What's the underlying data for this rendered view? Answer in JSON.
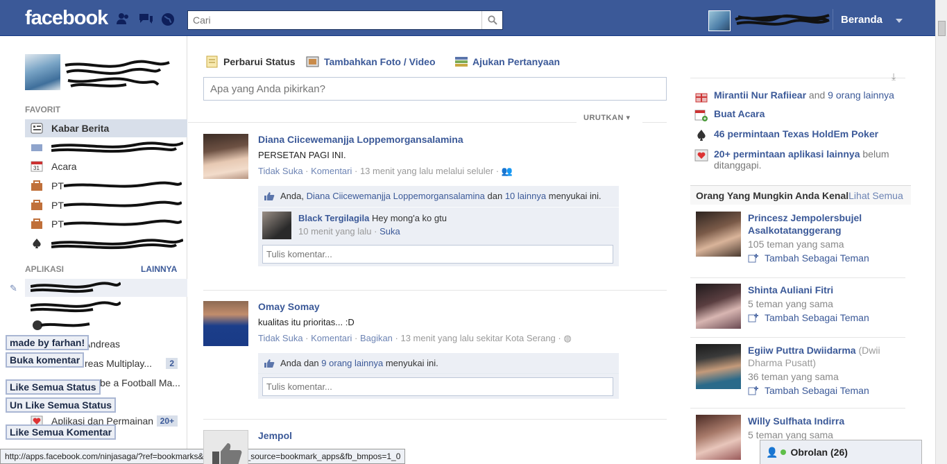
{
  "topbar": {
    "logo": "facebook",
    "search_placeholder": "Cari",
    "home_label": "Beranda"
  },
  "left": {
    "favorites_title": "FAVORIT",
    "favorites": [
      {
        "label": "Kabar Berita",
        "icon": "news-feed-icon",
        "active": true
      },
      {
        "label": "",
        "icon": "messages-icon"
      },
      {
        "label": "Acara",
        "icon": "calendar-icon"
      },
      {
        "label": "PT",
        "icon": "group-icon"
      },
      {
        "label": "PT",
        "icon": "group-icon"
      },
      {
        "label": "PT",
        "icon": "group-icon"
      },
      {
        "label": "",
        "icon": "spade-icon"
      }
    ],
    "apps_title": "APLIKASI",
    "apps_more": "LAINNYA",
    "apps": [
      {
        "label": "n Andreas"
      },
      {
        "label": "reas Multiplay...",
        "badge": "2"
      },
      {
        "label": "be a Football Ma..."
      },
      {
        "label": "Aplikasi dan Permainan",
        "badge": "20+"
      }
    ],
    "ext_buttons": [
      "made by farhan!",
      "Buka komentar",
      "Like Semua Status",
      "Un Like Semua Status",
      "Like Semua Komentar"
    ],
    "status_url": "http://apps.facebook.com/ninjasaga/?ref=bookmarks&count=0&fb_source=bookmark_apps&fb_bmpos=1_0"
  },
  "composer": {
    "tabs": [
      "Perbarui Status",
      "Tambahkan Foto / Video",
      "Ajukan Pertanyaan"
    ],
    "placeholder": "Apa yang Anda pikirkan?",
    "sort_label": "URUTKAN"
  },
  "stories": [
    {
      "author": "Diana Ciicewemanjja Loppemorgansalamina",
      "text": "PERSETAN PAGI INI.",
      "actions": [
        "Tidak Suka",
        "Komentari"
      ],
      "time": "13 menit yang lalu melalui seluler",
      "likes_prefix": "Anda,",
      "likes_name": "Diana Ciicewemanjja Loppemorgansalamina",
      "likes_mid": "dan",
      "likes_count": "10 lainnya",
      "likes_suffix": "menyukai ini.",
      "comment_author": "Black Tergilagila",
      "comment_text": "Hey mong'a ko gtu",
      "comment_time": "10 menit yang lalu",
      "comment_like": "Suka",
      "write_placeholder": "Tulis komentar..."
    },
    {
      "author": "Omay Somay",
      "text": "kualitas itu prioritas... :D",
      "actions": [
        "Tidak Suka",
        "Komentari",
        "Bagikan"
      ],
      "time": "13 menit yang lalu sekitar Kota Serang",
      "likes_prefix": "Anda dan",
      "likes_count": "9 orang lainnya",
      "likes_suffix": "menyukai ini.",
      "write_placeholder": "Tulis komentar..."
    },
    {
      "author": "Jempol"
    }
  ],
  "right": {
    "notifs": [
      {
        "bold": "Mirantii Nur Rafiiear",
        "plain": "and",
        "link": "9 orang lainnya",
        "icon": "gift-icon"
      },
      {
        "bold": "Buat Acara",
        "icon": "calendar-add-icon"
      },
      {
        "bold": "46 permintaan Texas HoldEm Poker",
        "icon": "spade-icon"
      },
      {
        "bold": "20+ permintaan aplikasi lainnya",
        "plain": "belum ditanggapi.",
        "icon": "app-request-icon"
      }
    ],
    "pymk_title": "Orang Yang Mungkin Anda Kenal",
    "pymk_see_all": "Lihat Semua",
    "add_friend_label": "Tambah Sebagai Teman",
    "people": [
      {
        "name": "Princesz Jempolersbujel Asalkotatanggerang",
        "mutual": "105 teman yang sama"
      },
      {
        "name": "Shinta Auliani Fitri",
        "mutual": "5 teman yang sama"
      },
      {
        "name": "Egiiw Puttra Dwiidarma",
        "alt": "(Dwii Dharma Pusatt)",
        "mutual": "36 teman yang sama"
      },
      {
        "name": "Willy Sulfhata Indirra",
        "mutual": "5 teman yang sama"
      }
    ],
    "chat_label": "Obrolan",
    "chat_count": "(26)"
  },
  "colors": {
    "brand": "#3b5998",
    "link": "#3b5998",
    "muted": "#999999",
    "ufi_bg": "#eceff5"
  }
}
